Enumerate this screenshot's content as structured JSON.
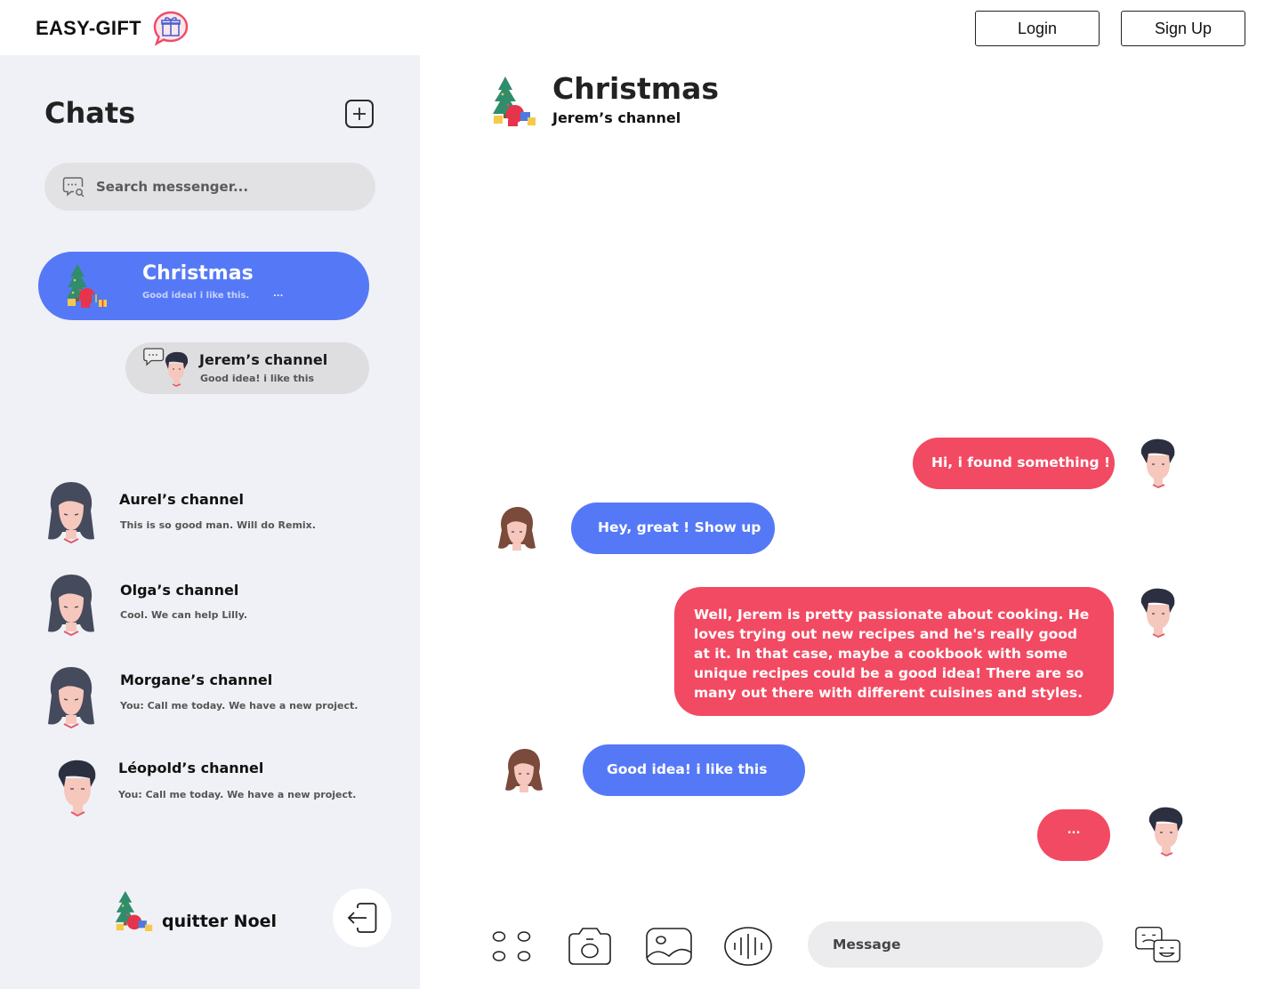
{
  "header": {
    "brand": "EASY-GIFT",
    "login_label": "Login",
    "signup_label": "Sign Up"
  },
  "sidebar": {
    "title": "Chats",
    "search_placeholder": "Search messenger...",
    "active_chat": {
      "name": "Christmas",
      "preview": "Good idea! i like this.",
      "more": "..."
    },
    "sub_chat": {
      "name": "Jerem’s channel",
      "preview": "Good idea! i like this"
    },
    "contacts": [
      {
        "name": "Aurel’s channel",
        "preview": "This is so good man. Will do Remix."
      },
      {
        "name": "Olga’s channel",
        "preview": "Cool. We can help Lilly."
      },
      {
        "name": "Morgane’s channel",
        "preview": "You: Call me today. We have a new project."
      },
      {
        "name": "Léopold’s channel",
        "preview": "You: Call me today. We have a new project."
      }
    ],
    "footer_label": "quitter Noel"
  },
  "conversation": {
    "title": "Christmas",
    "subtitle": "Jerem’s channel",
    "messages": [
      {
        "from": "me",
        "text": "Hi, i found something !"
      },
      {
        "from": "other",
        "text": "Hey, great ! Show up"
      },
      {
        "from": "me",
        "text": "Well, Jerem is pretty passionate about cooking. He loves trying out new recipes and he's really good at it. In that case, maybe a cookbook with some unique recipes could be a good idea! There are so many out there with different cuisines and styles."
      },
      {
        "from": "other",
        "text": "Good idea! i like this"
      },
      {
        "from": "me",
        "text": "..."
      }
    ],
    "input_placeholder": "Message"
  },
  "colors": {
    "accent_blue": "#5579f6",
    "accent_red": "#f24a62",
    "sidebar_bg": "#f0f1f6"
  },
  "icons": [
    "gift-chat-logo-icon",
    "plus-icon",
    "search-chat-icon",
    "christmas-tree-icon",
    "apps-icon",
    "camera-icon",
    "image-icon",
    "voice-icon",
    "emoji-icon",
    "logout-icon"
  ]
}
